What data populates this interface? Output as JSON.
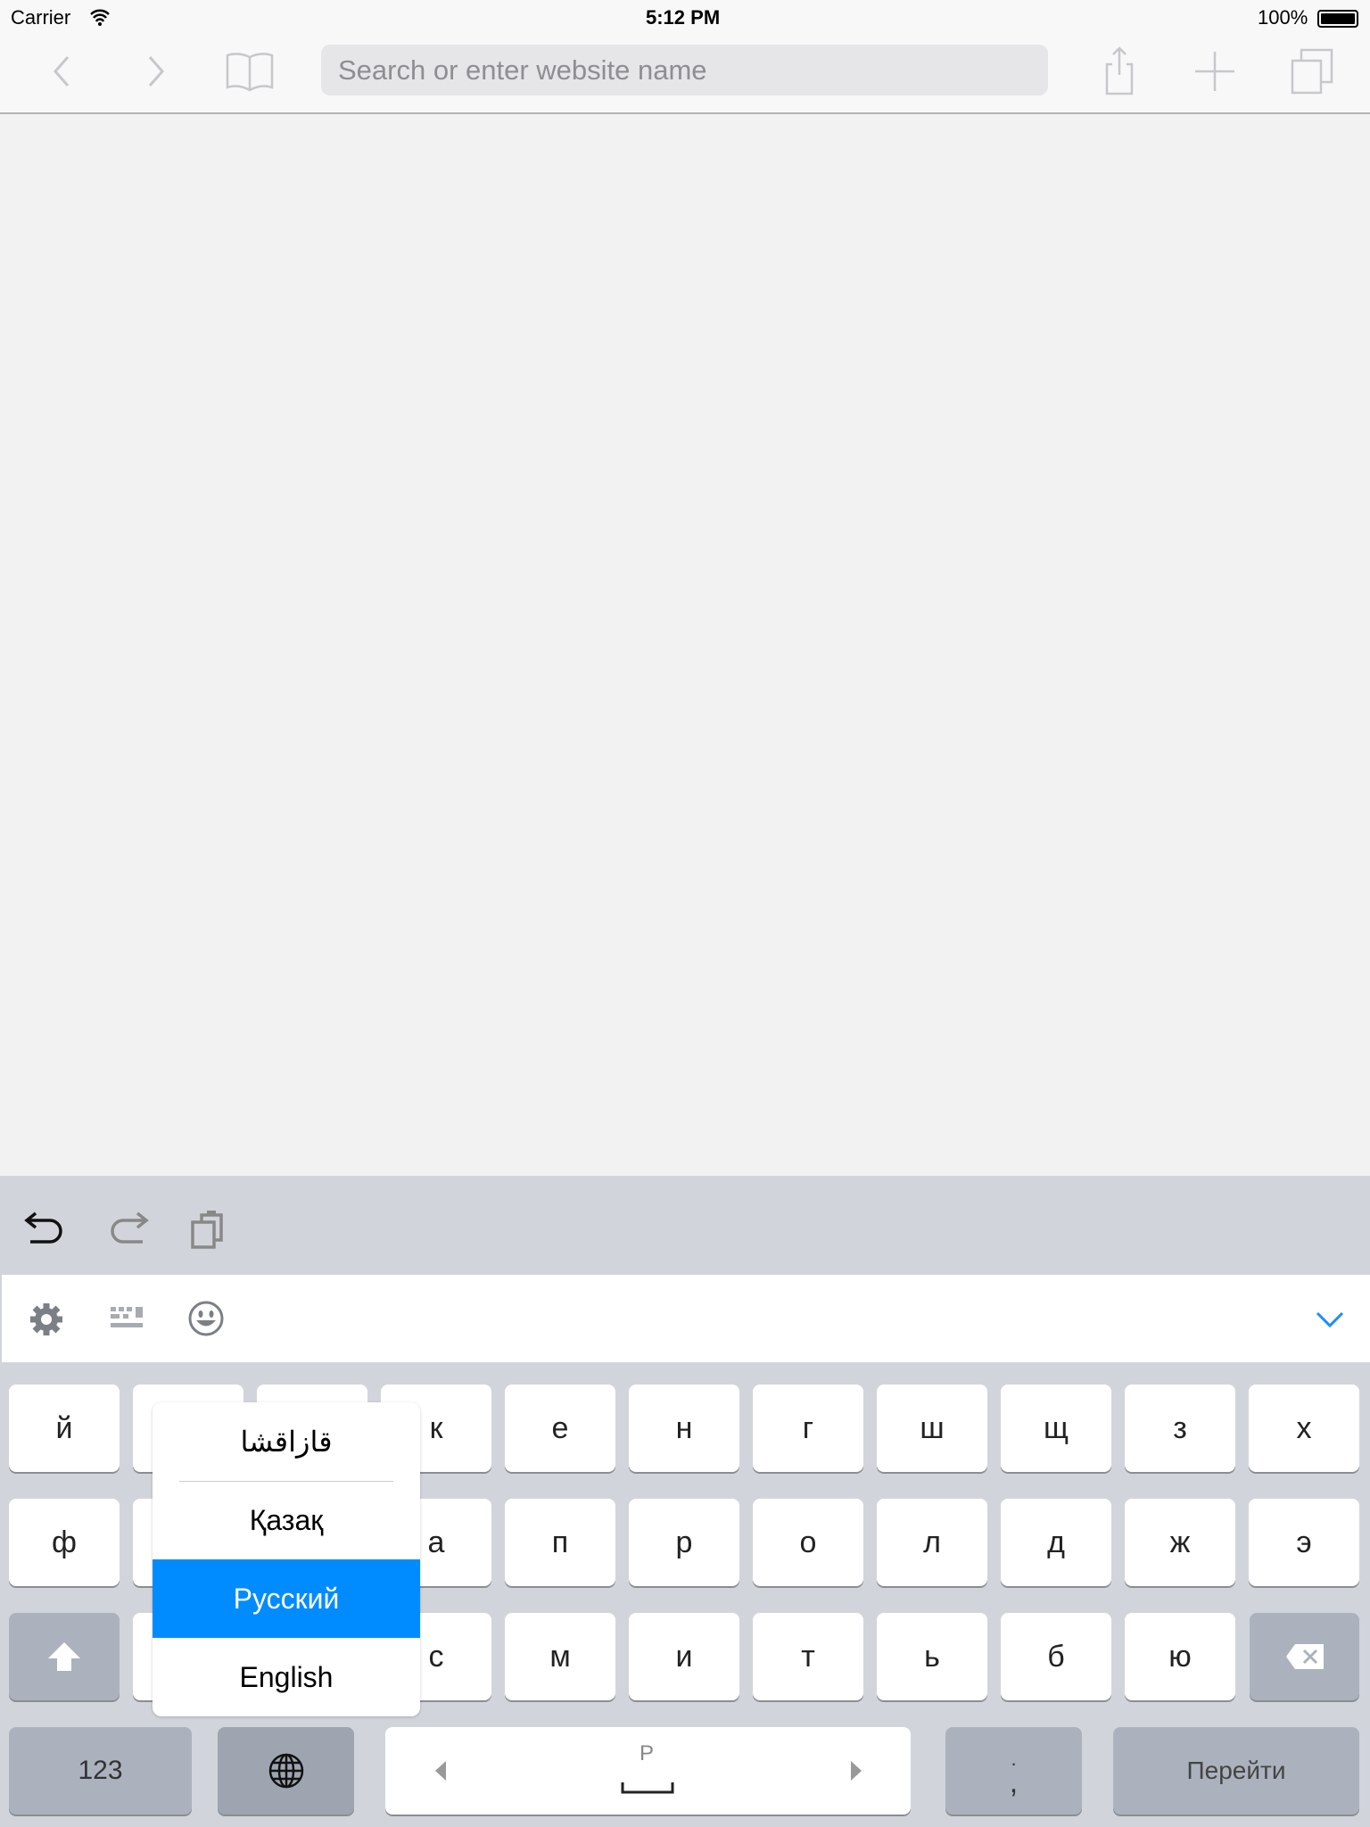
{
  "status": {
    "carrier": "Carrier",
    "time": "5:12 PM",
    "battery": "100%"
  },
  "toolbar": {
    "search_placeholder": "Search or enter website name",
    "icons": [
      "chevron-left-icon",
      "chevron-right-icon",
      "book-icon",
      "share-icon",
      "plus-icon",
      "tabs-icon"
    ]
  },
  "keyboard": {
    "row1": [
      "й",
      "",
      "",
      "к",
      "е",
      "н",
      "г",
      "ш",
      "щ",
      "з",
      "х"
    ],
    "row2": [
      "ф",
      "",
      "",
      "а",
      "п",
      "р",
      "о",
      "л",
      "д",
      "ж",
      "э"
    ],
    "row3": [
      "",
      "",
      "с",
      "м",
      "и",
      "т",
      "ь",
      "б",
      "ю"
    ],
    "numbers_label": "123",
    "space_hint": "Р",
    "punct_top": ".",
    "punct_bottom": ",",
    "go_label": "Перейти"
  },
  "language_menu": {
    "items": [
      "قازاقشا",
      "Қазақ",
      "Русский",
      "English"
    ],
    "selected": "Русский",
    "accent": "#008cff"
  }
}
